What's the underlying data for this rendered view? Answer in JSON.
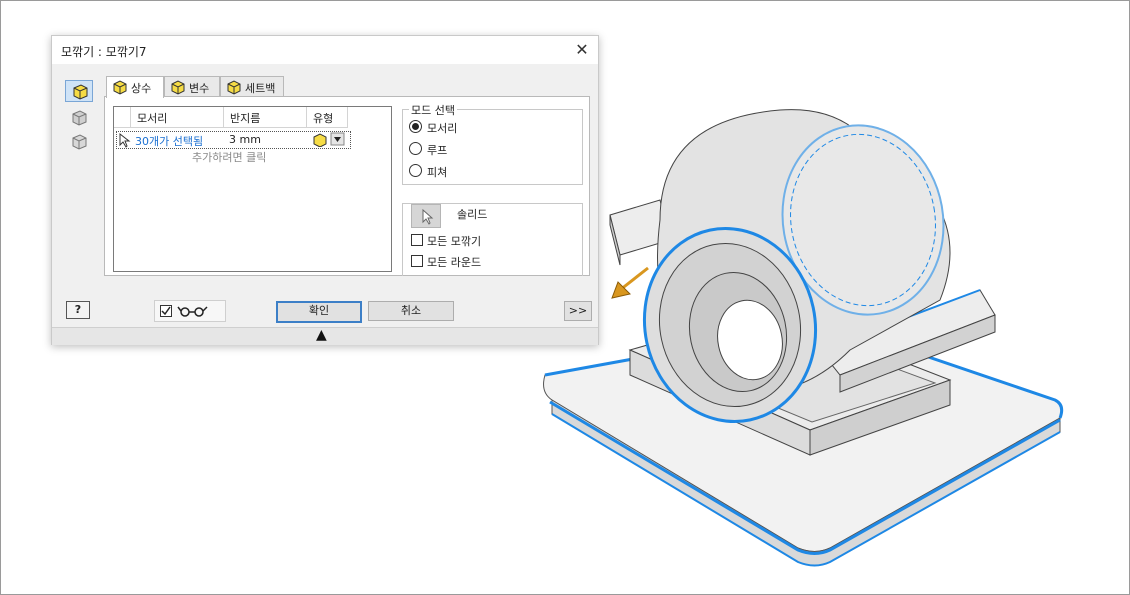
{
  "dialog": {
    "title": "모깎기 : 모깎기7",
    "close_glyph": "✕"
  },
  "tabs": [
    {
      "label": "상수"
    },
    {
      "label": "변수"
    },
    {
      "label": "세트백"
    }
  ],
  "table": {
    "headers": [
      "모서리",
      "반지름",
      "유형"
    ],
    "row": {
      "edges": "30개가 선택됨",
      "radius": "3 mm"
    },
    "add_hint": "추가하려면 클릭"
  },
  "mode_group": {
    "legend": "모드 선택",
    "options": [
      {
        "label": "모서리",
        "selected": true
      },
      {
        "label": "루프",
        "selected": false
      },
      {
        "label": "피쳐",
        "selected": false
      }
    ]
  },
  "solid_group": {
    "label": "솔리드",
    "options": [
      {
        "label": "모든 모깎기",
        "checked": false
      },
      {
        "label": "모든 라운드",
        "checked": false
      }
    ]
  },
  "footer": {
    "help_glyph": "?",
    "ok_label": "확인",
    "cancel_label": "취소",
    "more_label": ">>",
    "preview_checked": true,
    "collapse_glyph": "▲"
  },
  "colors": {
    "accent": "#3c7fc7",
    "selected_edge": "#1e88e5",
    "selected_text": "#1a6fd1",
    "arrow": "#d9971f",
    "model_fill": "#e9e9e9"
  },
  "icons": [
    "help-icon",
    "glasses-icon",
    "fillet-type-icon",
    "select-arrow-icon"
  ]
}
